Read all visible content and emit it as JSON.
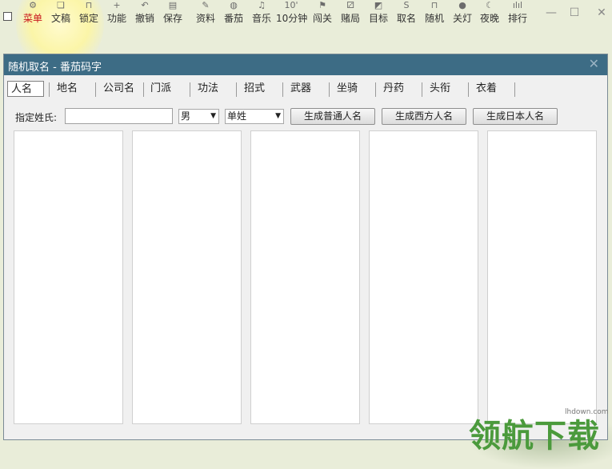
{
  "toolbar": {
    "items": [
      {
        "label": "菜单",
        "icon": "gear-icon",
        "glyph": "⚙"
      },
      {
        "label": "文稿",
        "icon": "book-icon",
        "glyph": "❏"
      },
      {
        "label": "锁定",
        "icon": "lock-icon",
        "glyph": "⊓"
      },
      {
        "label": "功能",
        "icon": "plus-icon",
        "glyph": "+"
      },
      {
        "label": "撤销",
        "icon": "undo-icon",
        "glyph": "↶"
      },
      {
        "label": "保存",
        "icon": "save-icon",
        "glyph": "▤"
      },
      {
        "label": "资料",
        "icon": "pen-icon",
        "glyph": "✎"
      },
      {
        "label": "番茄",
        "icon": "tomato-icon",
        "glyph": "◍"
      },
      {
        "label": "音乐",
        "icon": "music-icon",
        "glyph": "♫"
      },
      {
        "label": "10分钟",
        "icon": "ten-minutes-icon",
        "glyph": "10'"
      },
      {
        "label": "闯关",
        "icon": "flag-icon",
        "glyph": "⚑"
      },
      {
        "label": "赌局",
        "icon": "dice-icon",
        "glyph": "⚂"
      },
      {
        "label": "目标",
        "icon": "target-icon",
        "glyph": "◩"
      },
      {
        "label": "取名",
        "icon": "name-icon",
        "glyph": "ꓢ"
      },
      {
        "label": "随机",
        "icon": "random-icon",
        "glyph": "⊓"
      },
      {
        "label": "关灯",
        "icon": "bulb-icon",
        "glyph": "●"
      },
      {
        "label": "夜晚",
        "icon": "moon-icon",
        "glyph": "☾"
      },
      {
        "label": "排行",
        "icon": "rank-icon",
        "glyph": "ılıl"
      }
    ],
    "active_item": "菜单",
    "window_controls": {
      "minimize": "—",
      "maximize": "☐",
      "close": "✕"
    }
  },
  "dialog": {
    "title": "随机取名 - 番茄码字",
    "close": "✕",
    "tabs": [
      "人名",
      "地名",
      "公司名",
      "门派",
      "功法",
      "招式",
      "武器",
      "坐骑",
      "丹药",
      "头衔",
      "衣着"
    ],
    "selected_tab": "人名",
    "surname_label": "指定姓氏:",
    "surname_value": "",
    "gender_select": "男",
    "surname_type_select": "单姓",
    "buttons": {
      "common": "生成普通人名",
      "western": "生成西方人名",
      "japanese": "生成日本人名"
    },
    "result_panels": 5
  },
  "watermark": {
    "text": "领航下载",
    "url": "lhdown.com"
  },
  "colors": {
    "title_bar": "#3d6c85",
    "active_menu": "#c8161d",
    "watermark": "#4b9a3c"
  }
}
